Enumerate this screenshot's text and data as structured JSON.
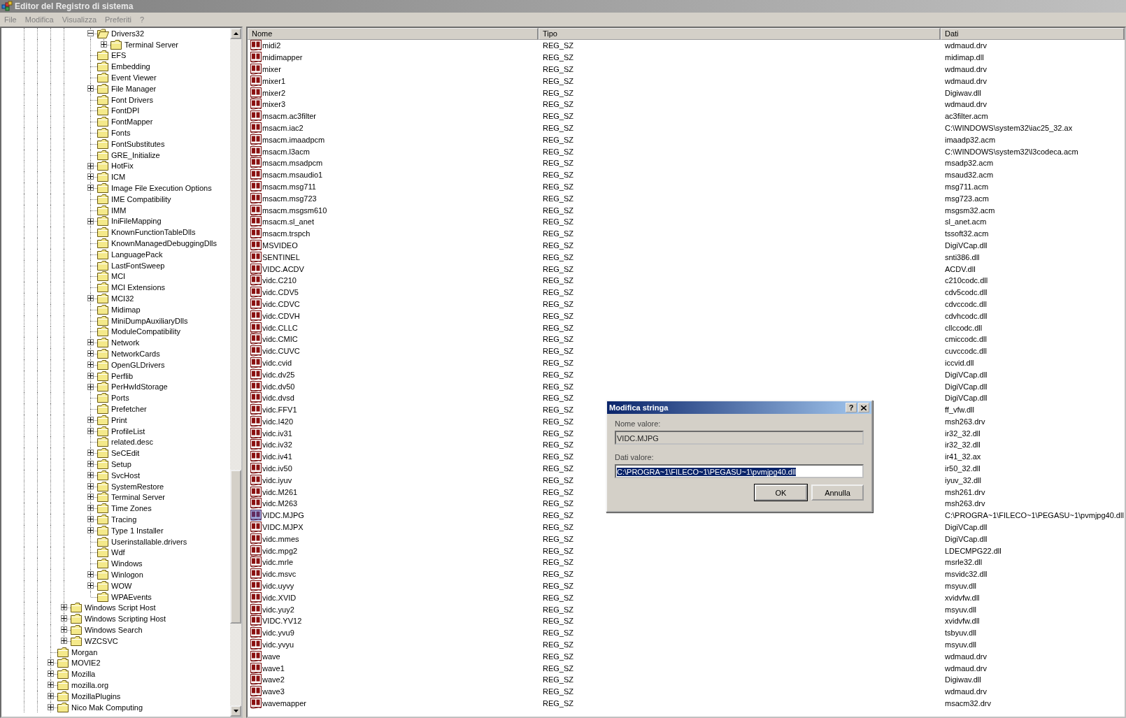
{
  "window": {
    "title": "Editor del Registro di sistema"
  },
  "menu": [
    "File",
    "Modifica",
    "Visualizza",
    "Preferiti",
    "?"
  ],
  "tree": {
    "children": [
      {
        "children": [
          {
            "children": [
              {
                "children": [
                  {
                    "children": [
                      {
                        "children": [
                          {
                            "label": "Drivers32",
                            "has_subkeys": true,
                            "expanded": true,
                            "children": [
                              {
                                "label": "Terminal Server",
                                "has_subkeys": true,
                                "expanded": false
                              }
                            ]
                          },
                          {
                            "label": "EFS",
                            "has_subkeys": false,
                            "expanded": false
                          },
                          {
                            "label": "Embedding",
                            "has_subkeys": false,
                            "expanded": false
                          },
                          {
                            "label": "Event Viewer",
                            "has_subkeys": false,
                            "expanded": false
                          },
                          {
                            "label": "File Manager",
                            "has_subkeys": true,
                            "expanded": false
                          },
                          {
                            "label": "Font Drivers",
                            "has_subkeys": false,
                            "expanded": false
                          },
                          {
                            "label": "FontDPI",
                            "has_subkeys": false,
                            "expanded": false
                          },
                          {
                            "label": "FontMapper",
                            "has_subkeys": false,
                            "expanded": false
                          },
                          {
                            "label": "Fonts",
                            "has_subkeys": false,
                            "expanded": false
                          },
                          {
                            "label": "FontSubstitutes",
                            "has_subkeys": false,
                            "expanded": false
                          },
                          {
                            "label": "GRE_Initialize",
                            "has_subkeys": false,
                            "expanded": false
                          },
                          {
                            "label": "HotFix",
                            "has_subkeys": true,
                            "expanded": false
                          },
                          {
                            "label": "ICM",
                            "has_subkeys": true,
                            "expanded": false
                          },
                          {
                            "label": "Image File Execution Options",
                            "has_subkeys": true,
                            "expanded": false
                          },
                          {
                            "label": "IME Compatibility",
                            "has_subkeys": false,
                            "expanded": false
                          },
                          {
                            "label": "IMM",
                            "has_subkeys": false,
                            "expanded": false
                          },
                          {
                            "label": "IniFileMapping",
                            "has_subkeys": true,
                            "expanded": false
                          },
                          {
                            "label": "KnownFunctionTableDlls",
                            "has_subkeys": false,
                            "expanded": false
                          },
                          {
                            "label": "KnownManagedDebuggingDlls",
                            "has_subkeys": false,
                            "expanded": false
                          },
                          {
                            "label": "LanguagePack",
                            "has_subkeys": false,
                            "expanded": false
                          },
                          {
                            "label": "LastFontSweep",
                            "has_subkeys": false,
                            "expanded": false
                          },
                          {
                            "label": "MCI",
                            "has_subkeys": false,
                            "expanded": false
                          },
                          {
                            "label": "MCI Extensions",
                            "has_subkeys": false,
                            "expanded": false
                          },
                          {
                            "label": "MCI32",
                            "has_subkeys": true,
                            "expanded": false
                          },
                          {
                            "label": "Midimap",
                            "has_subkeys": false,
                            "expanded": false
                          },
                          {
                            "label": "MiniDumpAuxiliaryDlls",
                            "has_subkeys": false,
                            "expanded": false
                          },
                          {
                            "label": "ModuleCompatibility",
                            "has_subkeys": false,
                            "expanded": false
                          },
                          {
                            "label": "Network",
                            "has_subkeys": true,
                            "expanded": false
                          },
                          {
                            "label": "NetworkCards",
                            "has_subkeys": true,
                            "expanded": false
                          },
                          {
                            "label": "OpenGLDrivers",
                            "has_subkeys": true,
                            "expanded": false
                          },
                          {
                            "label": "Perflib",
                            "has_subkeys": true,
                            "expanded": false
                          },
                          {
                            "label": "PerHwIdStorage",
                            "has_subkeys": true,
                            "expanded": false
                          },
                          {
                            "label": "Ports",
                            "has_subkeys": false,
                            "expanded": false
                          },
                          {
                            "label": "Prefetcher",
                            "has_subkeys": false,
                            "expanded": false
                          },
                          {
                            "label": "Print",
                            "has_subkeys": true,
                            "expanded": false
                          },
                          {
                            "label": "ProfileList",
                            "has_subkeys": true,
                            "expanded": false
                          },
                          {
                            "label": "related.desc",
                            "has_subkeys": false,
                            "expanded": false
                          },
                          {
                            "label": "SeCEdit",
                            "has_subkeys": true,
                            "expanded": false
                          },
                          {
                            "label": "Setup",
                            "has_subkeys": true,
                            "expanded": false
                          },
                          {
                            "label": "SvcHost",
                            "has_subkeys": true,
                            "expanded": false
                          },
                          {
                            "label": "SystemRestore",
                            "has_subkeys": true,
                            "expanded": false
                          },
                          {
                            "label": "Terminal Server",
                            "has_subkeys": true,
                            "expanded": false
                          },
                          {
                            "label": "Time Zones",
                            "has_subkeys": true,
                            "expanded": false
                          },
                          {
                            "label": "Tracing",
                            "has_subkeys": true,
                            "expanded": false
                          },
                          {
                            "label": "Type 1 Installer",
                            "has_subkeys": true,
                            "expanded": false
                          },
                          {
                            "label": "Userinstallable.drivers",
                            "has_subkeys": false,
                            "expanded": false
                          },
                          {
                            "label": "Wdf",
                            "has_subkeys": false,
                            "expanded": false
                          },
                          {
                            "label": "Windows",
                            "has_subkeys": false,
                            "expanded": false
                          },
                          {
                            "label": "Winlogon",
                            "has_subkeys": true,
                            "expanded": false
                          },
                          {
                            "label": "WOW",
                            "has_subkeys": true,
                            "expanded": false
                          },
                          {
                            "label": "WPAEvents",
                            "has_subkeys": false,
                            "expanded": false
                          }
                        ]
                      }
                    ]
                  },
                  {
                    "label": "Windows Script Host",
                    "has_subkeys": true,
                    "expanded": false
                  },
                  {
                    "label": "Windows Scripting Host",
                    "has_subkeys": true,
                    "expanded": false
                  },
                  {
                    "label": "Windows Search",
                    "has_subkeys": true,
                    "expanded": false
                  },
                  {
                    "label": "WZCSVC",
                    "has_subkeys": true,
                    "expanded": false
                  }
                ]
              },
              {
                "label": "Morgan",
                "has_subkeys": false,
                "expanded": false
              },
              {
                "label": "MOVIE2",
                "has_subkeys": true,
                "expanded": false
              },
              {
                "label": "Mozilla",
                "has_subkeys": true,
                "expanded": false
              },
              {
                "label": "mozilla.org",
                "has_subkeys": true,
                "expanded": false
              },
              {
                "label": "MozillaPlugins",
                "has_subkeys": true,
                "expanded": false
              },
              {
                "label": "Nico Mak Computing",
                "has_subkeys": true,
                "expanded": false
              }
            ]
          }
        ]
      }
    ]
  },
  "table": {
    "columns": [
      "Nome",
      "Tipo",
      "Dati"
    ],
    "rows": [
      {
        "name": "midi2",
        "type": "REG_SZ",
        "data": "wdmaud.drv",
        "selected": false
      },
      {
        "name": "midimapper",
        "type": "REG_SZ",
        "data": "midimap.dll",
        "selected": false
      },
      {
        "name": "mixer",
        "type": "REG_SZ",
        "data": "wdmaud.drv",
        "selected": false
      },
      {
        "name": "mixer1",
        "type": "REG_SZ",
        "data": "wdmaud.drv",
        "selected": false
      },
      {
        "name": "mixer2",
        "type": "REG_SZ",
        "data": "Digiwav.dll",
        "selected": false
      },
      {
        "name": "mixer3",
        "type": "REG_SZ",
        "data": "wdmaud.drv",
        "selected": false
      },
      {
        "name": "msacm.ac3filter",
        "type": "REG_SZ",
        "data": "ac3filter.acm",
        "selected": false
      },
      {
        "name": "msacm.iac2",
        "type": "REG_SZ",
        "data": "C:\\WINDOWS\\system32\\iac25_32.ax",
        "selected": false
      },
      {
        "name": "msacm.imaadpcm",
        "type": "REG_SZ",
        "data": "imaadp32.acm",
        "selected": false
      },
      {
        "name": "msacm.l3acm",
        "type": "REG_SZ",
        "data": "C:\\WINDOWS\\system32\\l3codeca.acm",
        "selected": false
      },
      {
        "name": "msacm.msadpcm",
        "type": "REG_SZ",
        "data": "msadp32.acm",
        "selected": false
      },
      {
        "name": "msacm.msaudio1",
        "type": "REG_SZ",
        "data": "msaud32.acm",
        "selected": false
      },
      {
        "name": "msacm.msg711",
        "type": "REG_SZ",
        "data": "msg711.acm",
        "selected": false
      },
      {
        "name": "msacm.msg723",
        "type": "REG_SZ",
        "data": "msg723.acm",
        "selected": false
      },
      {
        "name": "msacm.msgsm610",
        "type": "REG_SZ",
        "data": "msgsm32.acm",
        "selected": false
      },
      {
        "name": "msacm.sl_anet",
        "type": "REG_SZ",
        "data": "sl_anet.acm",
        "selected": false
      },
      {
        "name": "msacm.trspch",
        "type": "REG_SZ",
        "data": "tssoft32.acm",
        "selected": false
      },
      {
        "name": "MSVIDEO",
        "type": "REG_SZ",
        "data": "DigiVCap.dll",
        "selected": false
      },
      {
        "name": "SENTINEL",
        "type": "REG_SZ",
        "data": "snti386.dll",
        "selected": false
      },
      {
        "name": "VIDC.ACDV",
        "type": "REG_SZ",
        "data": "ACDV.dll",
        "selected": false
      },
      {
        "name": "vidc.C210",
        "type": "REG_SZ",
        "data": "c210codc.dll",
        "selected": false
      },
      {
        "name": "vidc.CDV5",
        "type": "REG_SZ",
        "data": "cdv5codc.dll",
        "selected": false
      },
      {
        "name": "vidc.CDVC",
        "type": "REG_SZ",
        "data": "cdvccodc.dll",
        "selected": false
      },
      {
        "name": "vidc.CDVH",
        "type": "REG_SZ",
        "data": "cdvhcodc.dll",
        "selected": false
      },
      {
        "name": "vidc.CLLC",
        "type": "REG_SZ",
        "data": "cllccodc.dll",
        "selected": false
      },
      {
        "name": "vidc.CMIC",
        "type": "REG_SZ",
        "data": "cmiccodc.dll",
        "selected": false
      },
      {
        "name": "vidc.CUVC",
        "type": "REG_SZ",
        "data": "cuvccodc.dll",
        "selected": false
      },
      {
        "name": "vidc.cvid",
        "type": "REG_SZ",
        "data": "iccvid.dll",
        "selected": false
      },
      {
        "name": "vidc.dv25",
        "type": "REG_SZ",
        "data": "DigiVCap.dll",
        "selected": false
      },
      {
        "name": "vidc.dv50",
        "type": "REG_SZ",
        "data": "DigiVCap.dll",
        "selected": false
      },
      {
        "name": "vidc.dvsd",
        "type": "REG_SZ",
        "data": "DigiVCap.dll",
        "selected": false
      },
      {
        "name": "vidc.FFV1",
        "type": "REG_SZ",
        "data": "ff_vfw.dll",
        "selected": false
      },
      {
        "name": "vidc.I420",
        "type": "REG_SZ",
        "data": "msh263.drv",
        "selected": false
      },
      {
        "name": "vidc.iv31",
        "type": "REG_SZ",
        "data": "ir32_32.dll",
        "selected": false
      },
      {
        "name": "vidc.iv32",
        "type": "REG_SZ",
        "data": "ir32_32.dll",
        "selected": false
      },
      {
        "name": "vidc.iv41",
        "type": "REG_SZ",
        "data": "ir41_32.ax",
        "selected": false
      },
      {
        "name": "vidc.iv50",
        "type": "REG_SZ",
        "data": "ir50_32.dll",
        "selected": false
      },
      {
        "name": "vidc.iyuv",
        "type": "REG_SZ",
        "data": "iyuv_32.dll",
        "selected": false
      },
      {
        "name": "vidc.M261",
        "type": "REG_SZ",
        "data": "msh261.drv",
        "selected": false
      },
      {
        "name": "vidc.M263",
        "type": "REG_SZ",
        "data": "msh263.drv",
        "selected": false
      },
      {
        "name": "VIDC.MJPG",
        "type": "REG_SZ",
        "data": "C:\\PROGRA~1\\FILECO~1\\PEGASU~1\\pvmjpg40.dll",
        "selected": true
      },
      {
        "name": "VIDC.MJPX",
        "type": "REG_SZ",
        "data": "DigiVCap.dll",
        "selected": false
      },
      {
        "name": "vidc.mmes",
        "type": "REG_SZ",
        "data": "DigiVCap.dll",
        "selected": false
      },
      {
        "name": "vidc.mpg2",
        "type": "REG_SZ",
        "data": "LDECMPG22.dll",
        "selected": false
      },
      {
        "name": "vidc.mrle",
        "type": "REG_SZ",
        "data": "msrle32.dll",
        "selected": false
      },
      {
        "name": "vidc.msvc",
        "type": "REG_SZ",
        "data": "msvidc32.dll",
        "selected": false
      },
      {
        "name": "vidc.uyvy",
        "type": "REG_SZ",
        "data": "msyuv.dll",
        "selected": false
      },
      {
        "name": "vidc.XVID",
        "type": "REG_SZ",
        "data": "xvidvfw.dll",
        "selected": false
      },
      {
        "name": "vidc.yuy2",
        "type": "REG_SZ",
        "data": "msyuv.dll",
        "selected": false
      },
      {
        "name": "VIDC.YV12",
        "type": "REG_SZ",
        "data": "xvidvfw.dll",
        "selected": false
      },
      {
        "name": "vidc.yvu9",
        "type": "REG_SZ",
        "data": "tsbyuv.dll",
        "selected": false
      },
      {
        "name": "vidc.yvyu",
        "type": "REG_SZ",
        "data": "msyuv.dll",
        "selected": false
      },
      {
        "name": "wave",
        "type": "REG_SZ",
        "data": "wdmaud.drv",
        "selected": false
      },
      {
        "name": "wave1",
        "type": "REG_SZ",
        "data": "wdmaud.drv",
        "selected": false
      },
      {
        "name": "wave2",
        "type": "REG_SZ",
        "data": "Digiwav.dll",
        "selected": false
      },
      {
        "name": "wave3",
        "type": "REG_SZ",
        "data": "wdmaud.drv",
        "selected": false
      },
      {
        "name": "wavemapper",
        "type": "REG_SZ",
        "data": "msacm32.drv",
        "selected": false
      }
    ]
  },
  "dialog": {
    "title": "Modifica stringa",
    "help_button": "?",
    "name_label": "Nome valore:",
    "name_value": "VIDC.MJPG",
    "data_label": "Dati valore:",
    "data_value": "C:\\PROGRA~1\\FILECO~1\\PEGASU~1\\pvmjpg40.dll",
    "data_value_selected": true,
    "buttons": [
      {
        "label": "OK",
        "default": true
      },
      {
        "label": "Annulla",
        "default": false
      }
    ]
  }
}
